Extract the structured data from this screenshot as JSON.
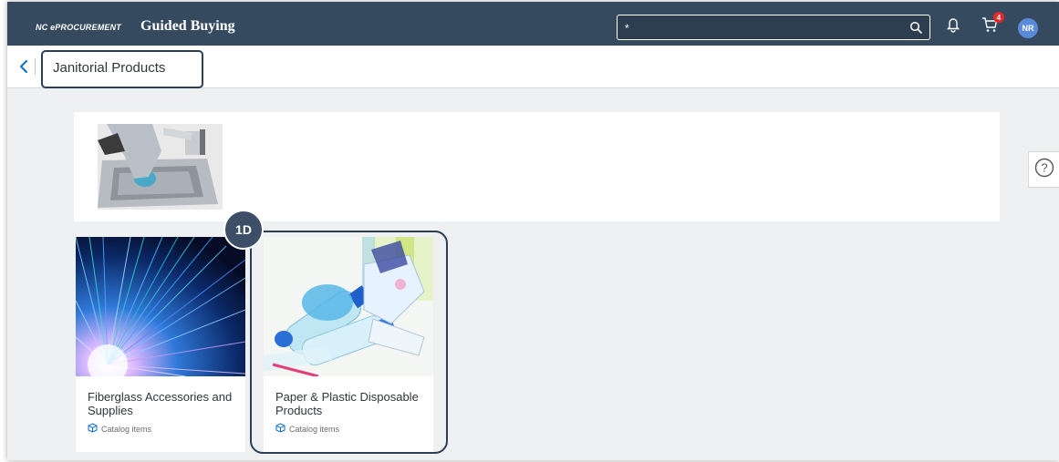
{
  "header": {
    "brand_small": "NC ePROCUREMENT",
    "brand_main": "Guided Buying",
    "search": {
      "value": "*",
      "placeholder": ""
    },
    "cart_count": "4",
    "avatar_initials": "NR"
  },
  "subheader": {
    "title": "Janitorial Products"
  },
  "annotation": {
    "step_label": "1D"
  },
  "tiles": [
    {
      "title": "Fiberglass Accessories and Supplies",
      "subtitle": "Catalog items"
    },
    {
      "title": "Paper & Plastic Disposable Products",
      "subtitle": "Catalog items"
    }
  ],
  "colors": {
    "shellbar": "#354a5f",
    "accent": "#0a6ed1",
    "annotation": "#2d3f55",
    "badge": "#e52929"
  },
  "icons": [
    "search-icon",
    "bell-icon",
    "cart-icon",
    "back-icon",
    "help-icon",
    "catalog-icon"
  ]
}
